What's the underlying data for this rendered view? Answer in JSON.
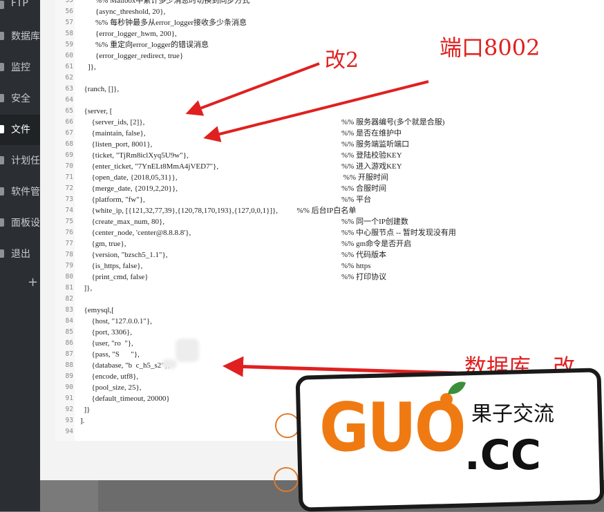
{
  "sidebar": {
    "items": [
      {
        "label": "FTP",
        "icon": "ftp-icon",
        "active": false
      },
      {
        "label": "数据库",
        "icon": "database-icon",
        "active": false
      },
      {
        "label": "监控",
        "icon": "monitor-icon",
        "active": false
      },
      {
        "label": "安全",
        "icon": "shield-icon",
        "active": false
      },
      {
        "label": "文件",
        "icon": "folder-icon",
        "active": true
      },
      {
        "label": "计划任",
        "icon": "clock-icon",
        "active": false
      },
      {
        "label": "软件管",
        "icon": "apps-icon",
        "active": false
      },
      {
        "label": "面板设",
        "icon": "settings-icon",
        "active": false
      },
      {
        "label": "退出",
        "icon": "logout-icon",
        "active": false
      }
    ],
    "add_label": "+"
  },
  "editor": {
    "lines": [
      {
        "n": "55",
        "code": "        %% Mailbox中累计多少消息时切换到同步方式",
        "comment": ""
      },
      {
        "n": "56",
        "code": "        {async_threshold, 20},",
        "comment": ""
      },
      {
        "n": "57",
        "code": "        %% 每秒钟最多从error_logger接收多少条消息",
        "comment": ""
      },
      {
        "n": "58",
        "code": "        {error_logger_hwm, 200},",
        "comment": ""
      },
      {
        "n": "59",
        "code": "        %% 重定向error_logger的错误消息",
        "comment": ""
      },
      {
        "n": "60",
        "code": "        {error_logger_redirect, true}",
        "comment": ""
      },
      {
        "n": "61",
        "code": "    ]},",
        "comment": ""
      },
      {
        "n": "62",
        "code": "",
        "comment": ""
      },
      {
        "n": "63",
        "code": "  {ranch, []},",
        "comment": ""
      },
      {
        "n": "64",
        "code": "",
        "comment": ""
      },
      {
        "n": "65",
        "code": "  {server, [",
        "comment": ""
      },
      {
        "n": "66",
        "code": "      {server_ids, [2]},",
        "comment": "%% 服务器编号(多个就是合服)"
      },
      {
        "n": "67",
        "code": "      {maintain, false},",
        "comment": "%% 是否在维护中"
      },
      {
        "n": "68",
        "code": "      {listen_port, 8001},",
        "comment": "%% 服务端监听端口"
      },
      {
        "n": "69",
        "code": "      {ticket, \"TjRm8iclXyq5U9w\"},",
        "comment": "%% 登陆校验KEY"
      },
      {
        "n": "70",
        "code": "      {enter_ticket, \"7YnELt8MmA4jVED7\"},",
        "comment": "%% 进入游戏KEY"
      },
      {
        "n": "71",
        "code": "      {open_date, {2018,05,31}},",
        "comment": " %% 开服时间"
      },
      {
        "n": "72",
        "code": "      {merge_date, {2019,2,20}},",
        "comment": "%% 合服时间"
      },
      {
        "n": "73",
        "code": "      {platform, \"fw\"},",
        "comment": "%% 平台"
      },
      {
        "n": "74",
        "code": "      {white_ip, [{121,32,77,39},{120,78,170,193},{127,0,0,1}]},          %% 后台IP白名单",
        "comment": ""
      },
      {
        "n": "75",
        "code": "      {create_max_num, 80},",
        "comment": "%% 同一个IP创建数"
      },
      {
        "n": "76",
        "code": "      {center_node, 'center@8.8.8.8'},",
        "comment": "%% 中心服节点 -- 暂时发现没有用"
      },
      {
        "n": "77",
        "code": "      {gm, true},",
        "comment": "%% gm命令是否开启"
      },
      {
        "n": "78",
        "code": "      {version, \"bzsch5_1.1\"},",
        "comment": "%% 代码版本"
      },
      {
        "n": "79",
        "code": "      {is_https, false},",
        "comment": "%% https"
      },
      {
        "n": "80",
        "code": "      {print_cmd, false}",
        "comment": "%% 打印协议"
      },
      {
        "n": "81",
        "code": "  ]},",
        "comment": ""
      },
      {
        "n": "82",
        "code": "",
        "comment": ""
      },
      {
        "n": "83",
        "code": "  {emysql,[",
        "comment": ""
      },
      {
        "n": "84",
        "code": "      {host, \"127.0.0.1\"},",
        "comment": ""
      },
      {
        "n": "85",
        "code": "      {port, 3306},",
        "comment": ""
      },
      {
        "n": "86",
        "code": "      {user, \"ro  \"},",
        "comment": ""
      },
      {
        "n": "87",
        "code": "      {pass, \"S      \"},",
        "comment": ""
      },
      {
        "n": "88",
        "code": "      {database, \"b  c_h5_s2\"},",
        "comment": ""
      },
      {
        "n": "89",
        "code": "      {encode, utf8},",
        "comment": ""
      },
      {
        "n": "90",
        "code": "      {pool_size, 25},",
        "comment": ""
      },
      {
        "n": "91",
        "code": "      {default_timeout, 20000}",
        "comment": ""
      },
      {
        "n": "92",
        "code": "  ]}",
        "comment": ""
      },
      {
        "n": "93",
        "code": "].",
        "comment": ""
      },
      {
        "n": "94",
        "code": "",
        "comment": ""
      }
    ]
  },
  "annotations": {
    "change2": "改2",
    "port": "端口8002",
    "database": "数据库，改"
  },
  "watermark": {
    "brand": "GUO",
    "chinese": "果子交流",
    "domain": ".CC",
    "brand_color": "#f07a12"
  }
}
